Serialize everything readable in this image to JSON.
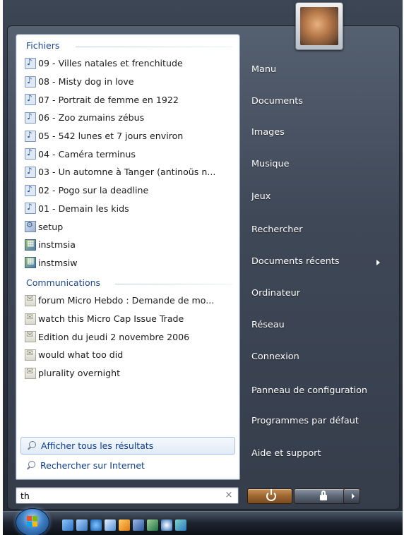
{
  "files_section": {
    "header": "Fichiers",
    "items": [
      {
        "icon": "audio-file-icon",
        "label": "09 - Villes natales et frenchitude"
      },
      {
        "icon": "audio-file-icon",
        "label": "08 - Misty dog in love"
      },
      {
        "icon": "audio-file-icon",
        "label": "07 - Portrait de femme en 1922"
      },
      {
        "icon": "audio-file-icon",
        "label": "06 - Zoo zumains zébus"
      },
      {
        "icon": "audio-file-icon",
        "label": "05 - 542 lunes et 7 jours environ"
      },
      {
        "icon": "audio-file-icon",
        "label": "04 - Caméra terminus"
      },
      {
        "icon": "audio-file-icon",
        "label": "03 - Un automne à Tanger (antinoüs n..."
      },
      {
        "icon": "audio-file-icon",
        "label": "02 - Pogo sur la deadline"
      },
      {
        "icon": "audio-file-icon",
        "label": "01 - Demain les kids"
      },
      {
        "icon": "setup-file-icon",
        "label": "setup"
      },
      {
        "icon": "installer-icon",
        "label": "instmsia"
      },
      {
        "icon": "installer-icon",
        "label": "instmsiw"
      }
    ]
  },
  "communications_section": {
    "header": "Communications",
    "items": [
      {
        "icon": "email-icon",
        "label": "forum Micro Hebdo : Demande de mo..."
      },
      {
        "icon": "email-icon",
        "label": "watch this Micro  Cap Issue Trade"
      },
      {
        "icon": "email-icon",
        "label": "Edition du jeudi 2 novembre 2006"
      },
      {
        "icon": "email-icon",
        "label": "would what too did"
      },
      {
        "icon": "email-icon",
        "label": "plurality overnight"
      }
    ]
  },
  "bottom_links": {
    "show_all": "Afficher tous les résultats",
    "search_internet": "Rechercher sur Internet"
  },
  "search": {
    "value": "th",
    "clear_symbol": "×"
  },
  "right_menu": {
    "items": [
      {
        "label": "Manu"
      },
      {
        "label": "Documents"
      },
      {
        "label": "Images"
      },
      {
        "label": "Musique"
      },
      {
        "label": "Jeux"
      },
      {
        "label": "Rechercher"
      },
      {
        "label": "Documents récents",
        "has_submenu": true
      },
      {
        "label": "Ordinateur"
      },
      {
        "label": "Réseau"
      },
      {
        "label": "Connexion"
      },
      {
        "label": "Panneau de configuration"
      },
      {
        "label": "Programmes par défaut"
      },
      {
        "label": "Aide et support"
      }
    ]
  },
  "power_buttons": {
    "power": "power-icon",
    "lock": "lock-icon",
    "more": "arrow-right-icon"
  },
  "taskbar": {
    "start": "windows-start-orb",
    "quick_launch": [
      "show-desktop-icon",
      "switch-windows-icon",
      "internet-explorer-icon",
      "windows-mail-icon",
      "media-center-icon",
      "word-icon",
      "excel-icon",
      "media-player-icon",
      "contacts-icon"
    ]
  },
  "colors": {
    "accent_blue": "#1e4a8a",
    "link_blue": "#0e3d8c",
    "power_orange": "#b2783e",
    "menu_dark": "#353d4b"
  }
}
